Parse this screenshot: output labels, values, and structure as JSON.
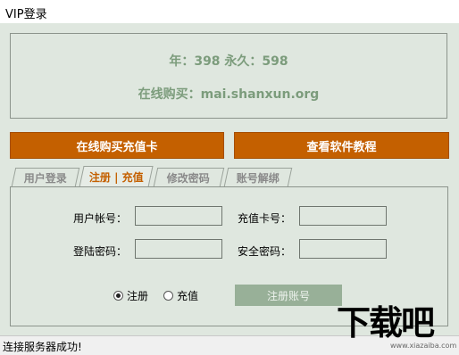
{
  "window": {
    "title": "VIP登录"
  },
  "pricing": {
    "line1": "年：398  永久：598",
    "line2": "在线购买：mai.shanxun.org"
  },
  "buttons": {
    "buy_card": "在线购买充值卡",
    "tutorial": "查看软件教程",
    "register_account": "注册账号"
  },
  "tabs": [
    {
      "label": "用户登录"
    },
    {
      "label": "注册 | 充值",
      "active": true
    },
    {
      "label": "修改密码"
    },
    {
      "label": "账号解绑"
    }
  ],
  "form": {
    "user_account_label": "用户帐号：",
    "login_password_label": "登陆密码：",
    "card_number_label": "充值卡号：",
    "security_password_label": "安全密码：",
    "user_account_value": "",
    "login_password_value": "",
    "card_number_value": "",
    "security_password_value": ""
  },
  "mode": {
    "register_label": "注册",
    "recharge_label": "充值",
    "selected": "注册"
  },
  "status": {
    "text": "连接服务器成功!"
  },
  "watermark": {
    "text": "下载吧",
    "url": "www.xiazaiba.com"
  },
  "colors": {
    "accent": "#c46000",
    "price_text": "#7c9c7c",
    "background": "#dfe7df",
    "disabled_button": "#98b098"
  }
}
